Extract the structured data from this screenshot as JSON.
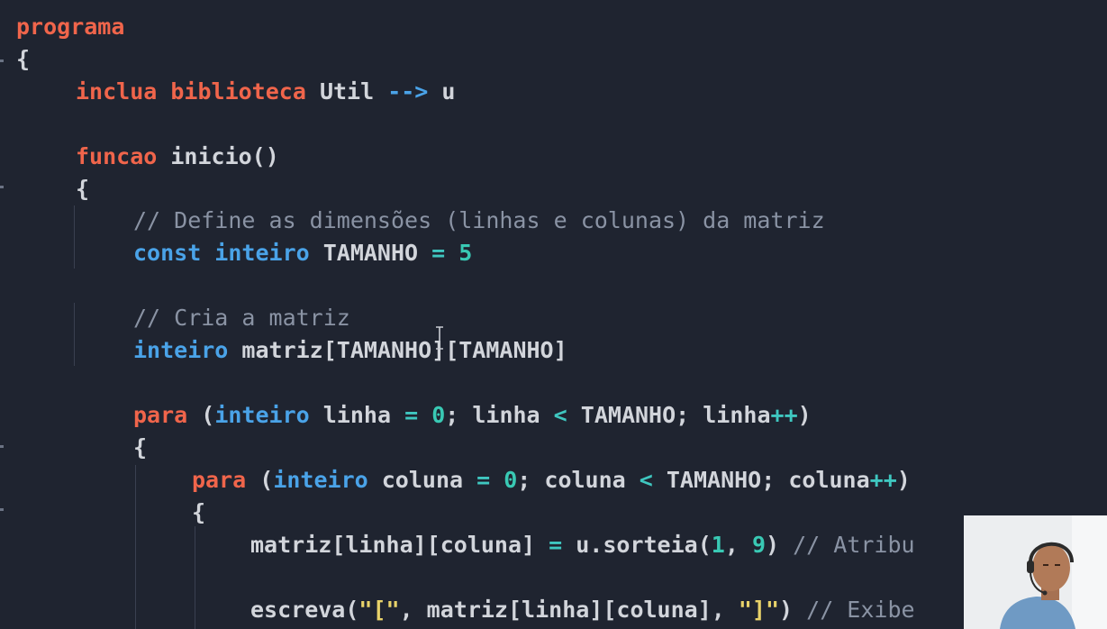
{
  "code_lines": [
    {
      "id": "l1",
      "tokens": [
        {
          "t": "programa",
          "c": "kw"
        }
      ]
    },
    {
      "id": "l2",
      "tokens": [
        {
          "t": "{",
          "c": "pl"
        }
      ]
    },
    {
      "id": "l3",
      "tokens": [
        {
          "t": "inclua biblioteca ",
          "c": "kw"
        },
        {
          "t": "Util ",
          "c": "pl"
        },
        {
          "t": "-->",
          "c": "blue"
        },
        {
          "t": " u",
          "c": "pl"
        }
      ]
    },
    {
      "id": "l4",
      "tokens": [
        {
          "t": "funcao ",
          "c": "kw"
        },
        {
          "t": "inicio()",
          "c": "pl"
        }
      ]
    },
    {
      "id": "l5",
      "tokens": [
        {
          "t": "{",
          "c": "pl"
        }
      ]
    },
    {
      "id": "l6",
      "tokens": [
        {
          "t": "// Define as dimensões (linhas e colunas) da matriz",
          "c": "cmt"
        }
      ]
    },
    {
      "id": "l7",
      "tokens": [
        {
          "t": "const inteiro ",
          "c": "blue"
        },
        {
          "t": "TAMANHO ",
          "c": "pl"
        },
        {
          "t": "=",
          "c": "teal"
        },
        {
          "t": " ",
          "c": "pl"
        },
        {
          "t": "5",
          "c": "num"
        }
      ]
    },
    {
      "id": "l8",
      "tokens": [
        {
          "t": "// Cria a matriz",
          "c": "cmt"
        }
      ]
    },
    {
      "id": "l9",
      "tokens": [
        {
          "t": "inteiro ",
          "c": "blue"
        },
        {
          "t": "matriz[TAMANHO][TAMANHO]",
          "c": "pl"
        }
      ]
    },
    {
      "id": "l10",
      "tokens": [
        {
          "t": "para ",
          "c": "kw"
        },
        {
          "t": "(",
          "c": "pl"
        },
        {
          "t": "inteiro ",
          "c": "blue"
        },
        {
          "t": "linha ",
          "c": "pl"
        },
        {
          "t": "=",
          "c": "teal"
        },
        {
          "t": " ",
          "c": "pl"
        },
        {
          "t": "0",
          "c": "num"
        },
        {
          "t": "; linha ",
          "c": "pl"
        },
        {
          "t": "<",
          "c": "teal"
        },
        {
          "t": " TAMANHO; linha",
          "c": "pl"
        },
        {
          "t": "++",
          "c": "teal"
        },
        {
          "t": ")",
          "c": "pl"
        }
      ]
    },
    {
      "id": "l11",
      "tokens": [
        {
          "t": "{",
          "c": "pl"
        }
      ]
    },
    {
      "id": "l12",
      "tokens": [
        {
          "t": "para ",
          "c": "kw"
        },
        {
          "t": "(",
          "c": "pl"
        },
        {
          "t": "inteiro ",
          "c": "blue"
        },
        {
          "t": "coluna ",
          "c": "pl"
        },
        {
          "t": "=",
          "c": "teal"
        },
        {
          "t": " ",
          "c": "pl"
        },
        {
          "t": "0",
          "c": "num"
        },
        {
          "t": "; coluna ",
          "c": "pl"
        },
        {
          "t": "<",
          "c": "teal"
        },
        {
          "t": " TAMANHO; coluna",
          "c": "pl"
        },
        {
          "t": "++",
          "c": "teal"
        },
        {
          "t": ")",
          "c": "pl"
        }
      ]
    },
    {
      "id": "l13",
      "tokens": [
        {
          "t": "{",
          "c": "pl"
        }
      ]
    },
    {
      "id": "l14",
      "tokens": [
        {
          "t": "matriz[linha][coluna] ",
          "c": "pl"
        },
        {
          "t": "=",
          "c": "teal"
        },
        {
          "t": " u.sorteia(",
          "c": "pl"
        },
        {
          "t": "1",
          "c": "num"
        },
        {
          "t": ", ",
          "c": "pl"
        },
        {
          "t": "9",
          "c": "num"
        },
        {
          "t": ") ",
          "c": "pl"
        },
        {
          "t": "// Atribu",
          "c": "cmt"
        }
      ]
    },
    {
      "id": "l15",
      "tokens": [
        {
          "t": "escreva(",
          "c": "pl"
        },
        {
          "t": "\"[\"",
          "c": "str"
        },
        {
          "t": ", matriz[linha][coluna], ",
          "c": "pl"
        },
        {
          "t": "\"]\"",
          "c": "str"
        },
        {
          "t": ") ",
          "c": "pl"
        },
        {
          "t": "// Exibe",
          "c": "cmt"
        }
      ]
    }
  ],
  "colors": {
    "background": "#1f2430",
    "keyword": "#f0654b",
    "type_keyword": "#4aa3e8",
    "operator": "#3fc7c0",
    "number": "#39c9b4",
    "string": "#e9d36a",
    "comment": "#8a93a4",
    "plain": "#d2d5db"
  },
  "webcam": {
    "icon": "presenter-video-icon"
  },
  "cursor": {
    "icon": "text-cursor-icon"
  }
}
